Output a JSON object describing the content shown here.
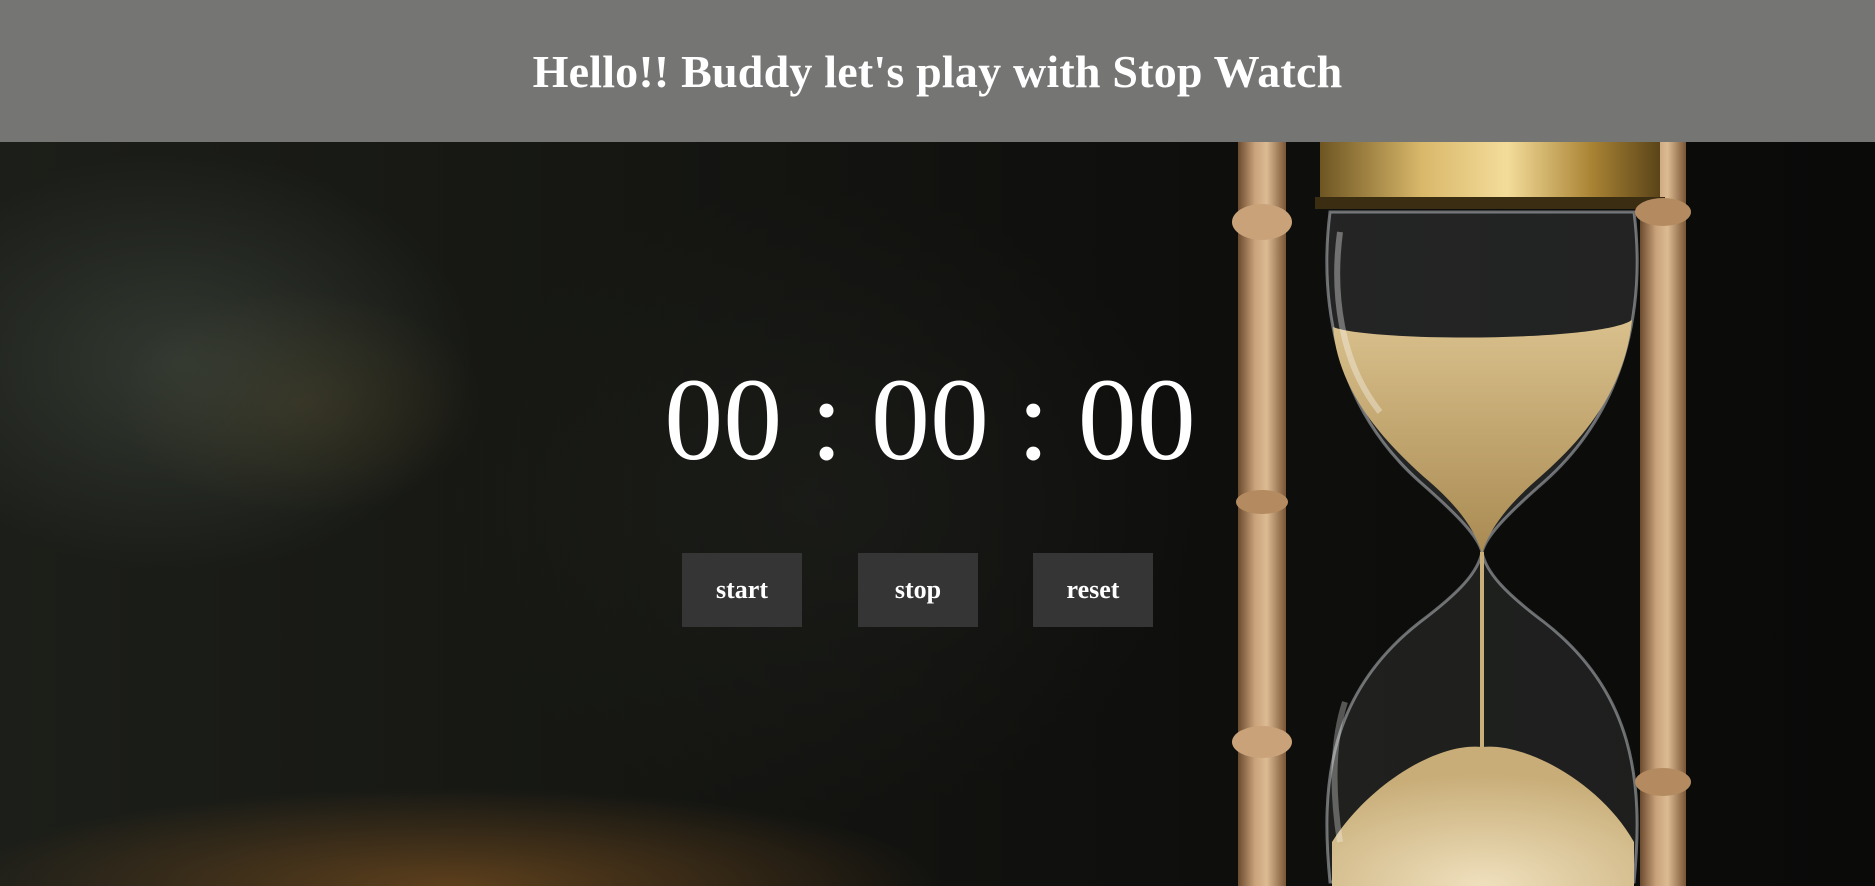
{
  "header": {
    "title": "Hello!! Buddy let's play with Stop Watch"
  },
  "stopwatch": {
    "hours": "00",
    "separator_1": ":",
    "minutes": "00",
    "separator_2": ":",
    "seconds": "00"
  },
  "controls": {
    "start_label": "start",
    "stop_label": "stop",
    "reset_label": "reset"
  },
  "background": {
    "image": "hourglass-image"
  },
  "colors": {
    "header_bg": "#757574",
    "button_bg": "#363535",
    "text": "#ffffff"
  }
}
